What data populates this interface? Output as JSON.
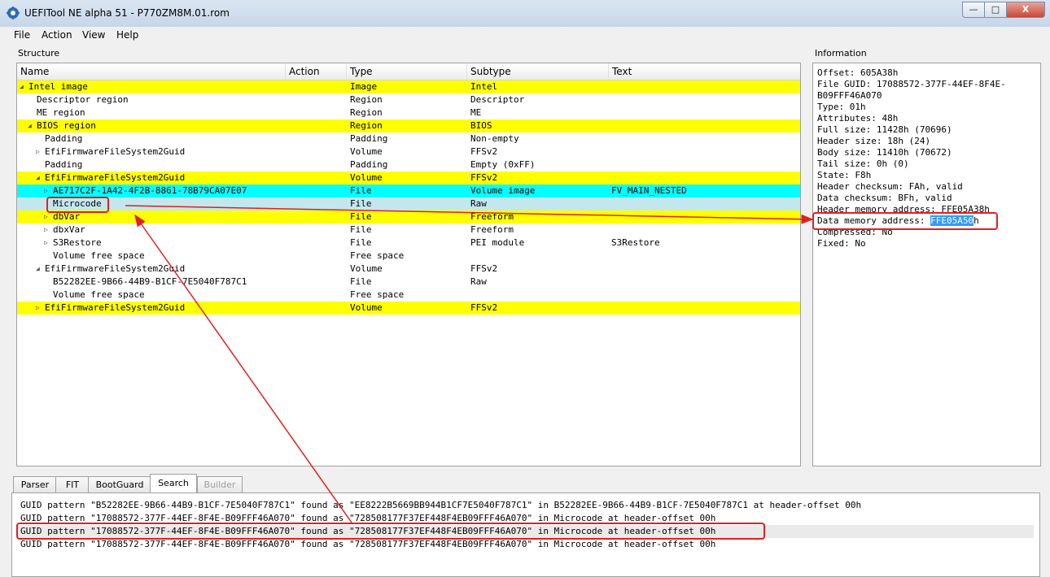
{
  "window": {
    "title": "UEFITool NE alpha 51 - P770ZM8M.01.rom",
    "minimize": "—",
    "maximize": "□",
    "close": "X"
  },
  "menu": [
    "File",
    "Action",
    "View",
    "Help"
  ],
  "structure": {
    "label": "Structure",
    "columns": [
      "Name",
      "Action",
      "Type",
      "Subtype",
      "Text"
    ],
    "rows": [
      {
        "name": "Intel image",
        "type": "Image",
        "subtype": "Intel",
        "text": "",
        "level": 0,
        "arrow": "down",
        "hl": "yellow"
      },
      {
        "name": "Descriptor region",
        "type": "Region",
        "subtype": "Descriptor",
        "text": "",
        "level": 1,
        "arrow": "",
        "hl": ""
      },
      {
        "name": "ME region",
        "type": "Region",
        "subtype": "ME",
        "text": "",
        "level": 1,
        "arrow": "",
        "hl": ""
      },
      {
        "name": "BIOS region",
        "type": "Region",
        "subtype": "BIOS",
        "text": "",
        "level": 1,
        "arrow": "down",
        "hl": "yellow"
      },
      {
        "name": "Padding",
        "type": "Padding",
        "subtype": "Non-empty",
        "text": "",
        "level": 2,
        "arrow": "",
        "hl": ""
      },
      {
        "name": "EfiFirmwareFileSystem2Guid",
        "type": "Volume",
        "subtype": "FFSv2",
        "text": "",
        "level": 2,
        "arrow": "right",
        "hl": ""
      },
      {
        "name": "Padding",
        "type": "Padding",
        "subtype": "Empty (0xFF)",
        "text": "",
        "level": 2,
        "arrow": "",
        "hl": ""
      },
      {
        "name": "EfiFirmwareFileSystem2Guid",
        "type": "Volume",
        "subtype": "FFSv2",
        "text": "",
        "level": 2,
        "arrow": "down",
        "hl": "yellow"
      },
      {
        "name": "AE717C2F-1A42-4F2B-8861-78B79CA07E07",
        "type": "File",
        "subtype": "Volume image",
        "text": "FV_MAIN_NESTED",
        "level": 3,
        "arrow": "right",
        "hl": "cyan"
      },
      {
        "name": "Microcode",
        "type": "File",
        "subtype": "Raw",
        "text": "",
        "level": 3,
        "arrow": "",
        "hl": "sel"
      },
      {
        "name": "dbVar",
        "type": "File",
        "subtype": "Freeform",
        "text": "",
        "level": 3,
        "arrow": "right",
        "hl": "yellow"
      },
      {
        "name": "dbxVar",
        "type": "File",
        "subtype": "Freeform",
        "text": "",
        "level": 3,
        "arrow": "right",
        "hl": ""
      },
      {
        "name": "S3Restore",
        "type": "File",
        "subtype": "PEI module",
        "text": "S3Restore",
        "level": 3,
        "arrow": "right",
        "hl": ""
      },
      {
        "name": "Volume free space",
        "type": "Free space",
        "subtype": "",
        "text": "",
        "level": 3,
        "arrow": "",
        "hl": ""
      },
      {
        "name": "EfiFirmwareFileSystem2Guid",
        "type": "Volume",
        "subtype": "FFSv2",
        "text": "",
        "level": 2,
        "arrow": "down",
        "hl": ""
      },
      {
        "name": "B52282EE-9B66-44B9-B1CF-7E5040F787C1",
        "type": "File",
        "subtype": "Raw",
        "text": "",
        "level": 3,
        "arrow": "",
        "hl": ""
      },
      {
        "name": "Volume free space",
        "type": "Free space",
        "subtype": "",
        "text": "",
        "level": 3,
        "arrow": "",
        "hl": ""
      },
      {
        "name": "EfiFirmwareFileSystem2Guid",
        "type": "Volume",
        "subtype": "FFSv2",
        "text": "",
        "level": 2,
        "arrow": "right",
        "hl": "yellow"
      }
    ]
  },
  "information": {
    "label": "Information",
    "lines": [
      "Offset: 605A38h",
      "File GUID: 17088572-377F-44EF-8F4E-",
      "B09FFF46A070",
      "Type: 01h",
      "Attributes: 48h",
      "Full size: 11428h (70696)",
      "Header size: 18h (24)",
      "Body size: 11410h (70672)",
      "Tail size: 0h (0)",
      "State: F8h",
      "Header checksum: FAh, valid",
      "Data checksum: BFh, valid",
      "Header memory address: FFE05A38h"
    ],
    "data_addr_prefix": "Data memory address: ",
    "data_addr_selected": "FFE05A50",
    "data_addr_suffix": "h",
    "tail_lines": [
      "Compressed: No",
      "Fixed: No"
    ]
  },
  "tabs": [
    "Parser",
    "FIT",
    "BootGuard",
    "Search",
    "Builder"
  ],
  "messages": [
    "GUID pattern \"B52282EE-9B66-44B9-B1CF-7E5040F787C1\" found as \"EE8222B5669BB944B1CF7E5040F787C1\" in B52282EE-9B66-44B9-B1CF-7E5040F787C1 at header-offset 00h",
    "GUID pattern \"17088572-377F-44EF-8F4E-B09FFF46A070\" found as \"728508177F37EF448F4EB09FFF46A070\" in Microcode at header-offset 00h",
    "GUID pattern \"17088572-377F-44EF-8F4E-B09FFF46A070\" found as \"728508177F37EF448F4EB09FFF46A070\" in Microcode at header-offset 00h",
    "GUID pattern \"17088572-377F-44EF-8F4E-B09FFF46A070\" found as \"728508177F37EF448F4EB09FFF46A070\" in Microcode at header-offset 00h"
  ],
  "colors": {
    "row_highlight_yellow": "#ffff00",
    "row_highlight_cyan": "#00ffff",
    "annotation_red": "#e02020",
    "selection_blue": "#3399ff"
  }
}
